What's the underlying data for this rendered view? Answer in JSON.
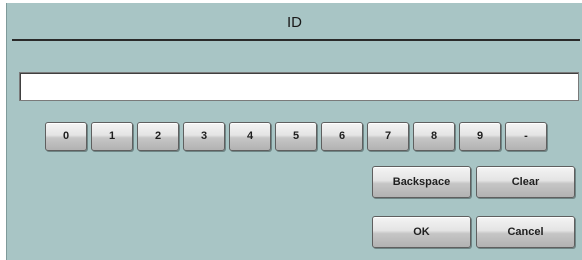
{
  "dialog": {
    "title": "ID",
    "input_value": ""
  },
  "keypad": {
    "keys": [
      "0",
      "1",
      "2",
      "3",
      "4",
      "5",
      "6",
      "7",
      "8",
      "9",
      "-"
    ]
  },
  "actions": {
    "backspace_label": "Backspace",
    "clear_label": "Clear",
    "ok_label": "OK",
    "cancel_label": "Cancel"
  },
  "colors": {
    "background": "#a8c5c5",
    "rule": "#2a2a2a"
  }
}
